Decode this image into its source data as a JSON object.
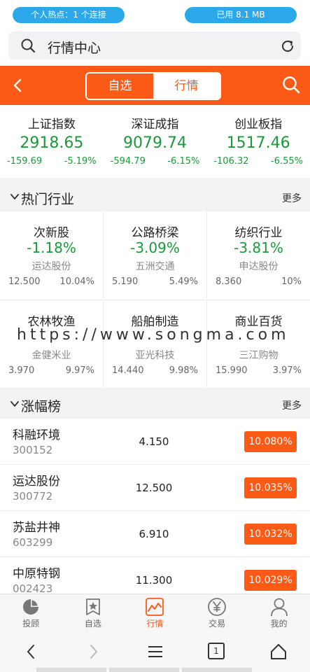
{
  "status": {
    "hotspot": "个人热点：1 个连接",
    "usage": "已用 8.1 MB"
  },
  "browser": {
    "search_text": "行情中心"
  },
  "header": {
    "tab_watchlist": "自选",
    "tab_market": "行情"
  },
  "indices": [
    {
      "name": "上证指数",
      "price": "2918.65",
      "change": "-159.69",
      "percent": "-5.19%"
    },
    {
      "name": "深证成指",
      "price": "9079.74",
      "change": "-594.79",
      "percent": "-6.15%"
    },
    {
      "name": "创业板指",
      "price": "1517.46",
      "change": "-106.32",
      "percent": "-6.55%"
    }
  ],
  "hot_industry": {
    "title": "热门行业",
    "more": "更多",
    "items": [
      {
        "name": "次新股",
        "percent": "-1.18%",
        "stock": "运达股份",
        "price": "12.500",
        "stock_percent": "10.04%"
      },
      {
        "name": "公路桥梁",
        "percent": "-3.09%",
        "stock": "五洲交通",
        "price": "5.190",
        "stock_percent": "5.49%"
      },
      {
        "name": "纺织行业",
        "percent": "-3.81%",
        "stock": "申达股份",
        "price": "8.360",
        "stock_percent": "10%"
      },
      {
        "name": "农林牧渔",
        "percent": "",
        "stock": "金健米业",
        "price": "3.970",
        "stock_percent": "9.97%"
      },
      {
        "name": "船舶制造",
        "percent": "",
        "stock": "亚光科技",
        "price": "14.440",
        "stock_percent": "9.98%"
      },
      {
        "name": "商业百货",
        "percent": "",
        "stock": "三江购物",
        "price": "15.990",
        "stock_percent": "3.97%"
      }
    ]
  },
  "watermark": "https://www.songma.com",
  "gainers": {
    "title": "涨幅榜",
    "more": "更多",
    "rows": [
      {
        "name": "科融环境",
        "code": "300152",
        "price": "4.150",
        "percent": "10.080%"
      },
      {
        "name": "运达股份",
        "code": "300772",
        "price": "12.500",
        "percent": "10.035%"
      },
      {
        "name": "苏盐井神",
        "code": "603299",
        "price": "6.910",
        "percent": "10.032%"
      },
      {
        "name": "中原特钢",
        "code": "002423",
        "price": "11.300",
        "percent": "10.029%"
      }
    ]
  },
  "tabbar": {
    "items": [
      {
        "label": "投顾",
        "icon": "pie-chart-icon"
      },
      {
        "label": "自选",
        "icon": "star-document-icon"
      },
      {
        "label": "行情",
        "icon": "line-chart-icon"
      },
      {
        "label": "交易",
        "icon": "yen-icon"
      },
      {
        "label": "我的",
        "icon": "user-icon"
      }
    ],
    "active": "行情"
  },
  "navbar": {
    "tab_count": "1"
  },
  "colors": {
    "accent": "#fb5a17",
    "down": "#1a9a3a",
    "pill": "#2aa8ea"
  }
}
